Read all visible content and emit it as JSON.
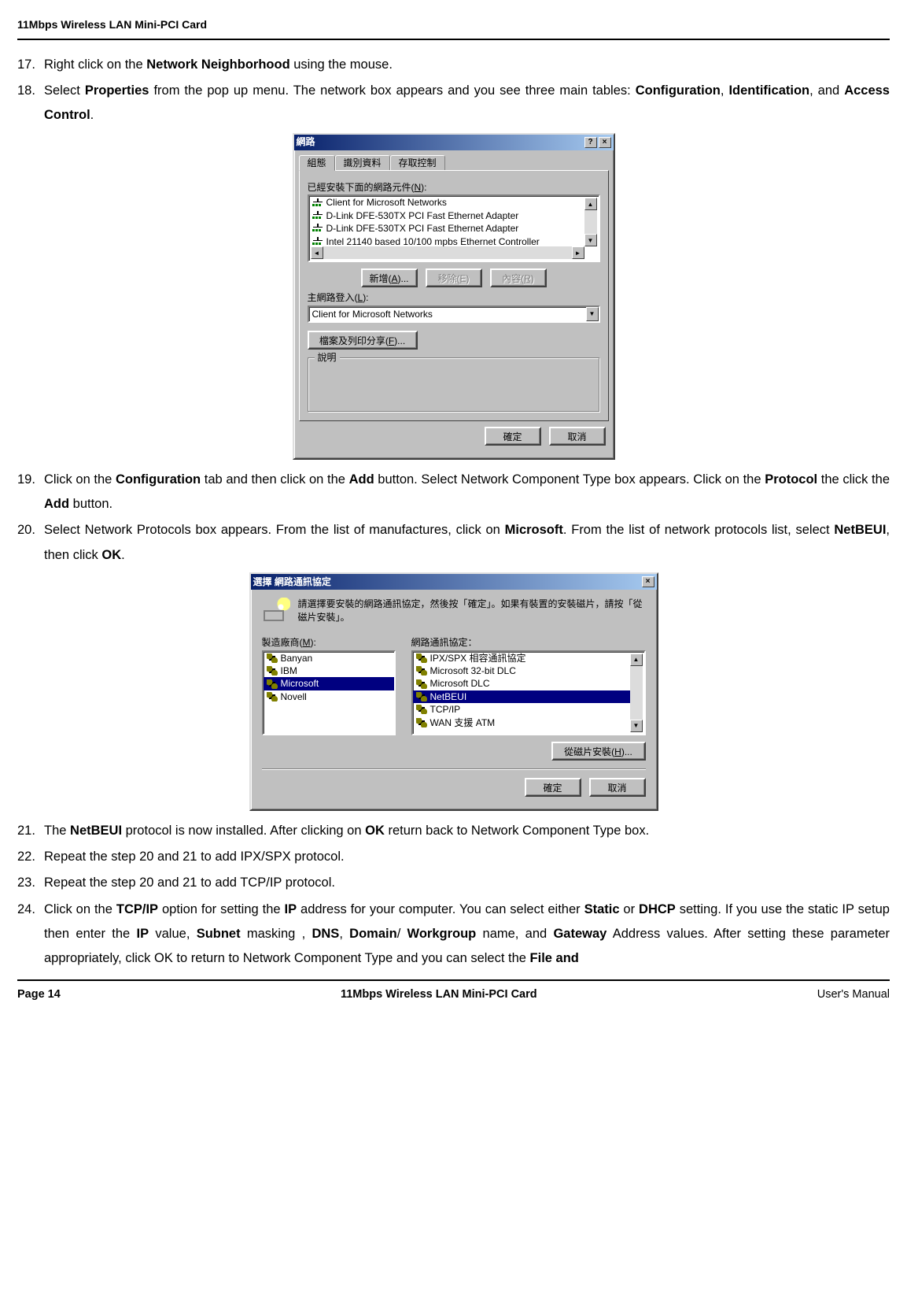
{
  "header": {
    "title": "11Mbps Wireless LAN Mini-PCI Card"
  },
  "footer": {
    "page": "Page 14",
    "center": "11Mbps Wireless LAN Mini-PCI Card",
    "right": "User's Manual"
  },
  "steps": {
    "s17": {
      "num": "17.",
      "pre": "Right click on the ",
      "b1": "Network Neighborhood",
      "post": " using the mouse."
    },
    "s18": {
      "num": "18.",
      "pre": "Select ",
      "b1": "Properties",
      "mid": " from the pop up menu. The network box appears and you see three main tables: ",
      "b2": "Configuration",
      "sep1": ", ",
      "b3": "Identification",
      "sep2": ", and ",
      "b4": "Access Control",
      "post": "."
    },
    "s19": {
      "num": "19.",
      "pre": "Click on the ",
      "b1": "Configuration",
      "mid1": " tab and then click on the ",
      "b2": "Add",
      "mid2": " button. Select Network Component Type box appears. Click on the ",
      "b3": "Protocol",
      "mid3": " the click the ",
      "b4": "Add",
      "post": " button."
    },
    "s20": {
      "num": "20.",
      "pre": "Select Network Protocols box appears. From the list of manufactures, click on ",
      "b1": "Microsoft",
      "mid1": ". From the list of network protocols list, select ",
      "b2": "NetBEUI",
      "mid2": ", then click ",
      "b3": "OK",
      "post": "."
    },
    "s21": {
      "num": "21.",
      "pre": "The ",
      "b1": "NetBEUI",
      "mid1": " protocol is now installed. After clicking on ",
      "b2": "OK",
      "post": " return back to Network Component Type box."
    },
    "s22": {
      "num": "22.",
      "text": "Repeat the step 20 and 21 to add IPX/SPX protocol."
    },
    "s23": {
      "num": "23.",
      "text": "Repeat the step 20 and 21 to add TCP/IP protocol."
    },
    "s24": {
      "num": "24.",
      "pre": "Click on the ",
      "b1": "TCP/IP",
      "mid1": " option for setting the ",
      "b2": "IP",
      "mid2": " address for your computer. You can select either ",
      "b3": "Static",
      "mid3": " or ",
      "b4": "DHCP",
      "mid4": " setting. If you use the static IP setup then enter the ",
      "b5": "IP",
      "mid5": " value, ",
      "b6": "Subnet",
      "mid6": " masking , ",
      "b7": "DNS",
      "mid7": ", ",
      "b8": "Domain",
      "mid8": "/ ",
      "b9": "Workgroup",
      "mid9": " name, and ",
      "b10": "Gateway",
      "mid10": " Address values. After setting these parameter appropriately, click OK to return to Network Component Type and you can select the ",
      "b11": "File and"
    }
  },
  "dlg1": {
    "title": "網路",
    "help": "?",
    "close": "×",
    "tabs": {
      "t1": "組態",
      "t2": "識別資料",
      "t3": "存取控制"
    },
    "label_installed_pre": "已經安裝下面的網路元件(",
    "label_installed_u": "N",
    "label_installed_post": "):",
    "components": {
      "c1": "Client for Microsoft Networks",
      "c2": "D-Link DFE-530TX PCI Fast Ethernet Adapter",
      "c3": "D-Link DFE-530TX PCI Fast Ethernet Adapter",
      "c4": "Intel 21140 based 10/100 mpbs Ethernet Controller"
    },
    "btn_add_pre": "新增(",
    "btn_add_u": "A",
    "btn_add_post": ")...",
    "btn_remove_pre": "移除(",
    "btn_remove_u": "E",
    "btn_remove_post": ")",
    "btn_prop_pre": "內容(",
    "btn_prop_u": "R",
    "btn_prop_post": ")",
    "label_logon_pre": "主網路登入(",
    "label_logon_u": "L",
    "label_logon_post": "):",
    "logon_value": "Client for Microsoft Networks",
    "btn_share_pre": "檔案及列印分享(",
    "btn_share_u": "F",
    "btn_share_post": ")...",
    "group_desc": "說明",
    "btn_ok": "確定",
    "btn_cancel": "取消"
  },
  "dlg2": {
    "title": "選擇 網路通訊協定",
    "close": "×",
    "instr": "請選擇要安裝的網路通訊協定，然後按「確定」。如果有裝置的安裝磁片，請按「從磁片安裝」。",
    "label_mfr_pre": "製造廠商(",
    "label_mfr_u": "M",
    "label_mfr_post": "):",
    "label_proto": "網路通訊協定：",
    "mfrs": {
      "m1": "Banyan",
      "m2": "IBM",
      "m3": "Microsoft",
      "m4": "Novell"
    },
    "protos": {
      "p1": "IPX/SPX 相容通訊協定",
      "p2": "Microsoft 32-bit DLC",
      "p3": "Microsoft DLC",
      "p4": "NetBEUI",
      "p5": "TCP/IP",
      "p6": "WAN 支援 ATM"
    },
    "btn_disk_pre": "從磁片安裝(",
    "btn_disk_u": "H",
    "btn_disk_post": ")...",
    "btn_ok": "確定",
    "btn_cancel": "取消"
  },
  "glyphs": {
    "tri_up": "▲",
    "tri_down": "▼",
    "tri_left": "◄",
    "tri_right": "►"
  }
}
